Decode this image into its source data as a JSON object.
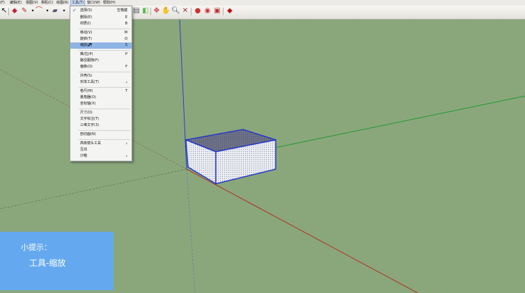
{
  "menubar": {
    "items": [
      "(F)",
      "编辑(E)",
      "视图(V)",
      "相机(C)",
      "绘图(R)",
      "工具(T)",
      "窗口(W)",
      "帮助(H)"
    ]
  },
  "toolbar": {
    "icons": [
      "select-arrow-icon",
      "eraser-icon",
      "pencil-icon",
      "arc-icon",
      "shape-icon",
      "push-pull-icon",
      "orbit-icon",
      "pan-icon",
      "zoom-icon",
      "zoom-extents-icon",
      "warehouse-icon",
      "extension-icon",
      "layout-icon",
      "ruby-icon"
    ]
  },
  "tools_menu": {
    "items": [
      {
        "label": "选择(S)",
        "shortcut": "空格键",
        "checked": true
      },
      {
        "label": "删除(E)",
        "shortcut": "E"
      },
      {
        "label": "材质(I)",
        "shortcut": "B"
      },
      {
        "label": "移动(V)",
        "shortcut": "M"
      },
      {
        "label": "旋转(T)",
        "shortcut": "Q"
      },
      {
        "label": "缩放(C)",
        "shortcut": "S",
        "highlighted": true
      },
      {
        "label": "推/拉(P)",
        "shortcut": "P"
      },
      {
        "label": "路径跟随(F)",
        "shortcut": ""
      },
      {
        "label": "偏移(O)",
        "shortcut": "F"
      },
      {
        "label": "外壳(S)",
        "shortcut": ""
      },
      {
        "label": "实体工具(T)",
        "shortcut": "",
        "submenu": true
      },
      {
        "label": "卷尺(M)",
        "shortcut": "T"
      },
      {
        "label": "量角器(O)",
        "shortcut": ""
      },
      {
        "label": "坐标轴(X)",
        "shortcut": ""
      },
      {
        "label": "尺寸(D)",
        "shortcut": ""
      },
      {
        "label": "文字标注(T)",
        "shortcut": ""
      },
      {
        "label": "三维文字(3)",
        "shortcut": ""
      },
      {
        "label": "剖切面(N)",
        "shortcut": ""
      },
      {
        "label": "高级镜头工具",
        "shortcut": "",
        "submenu": true
      },
      {
        "label": "互动",
        "shortcut": ""
      },
      {
        "label": "沙箱",
        "shortcut": "",
        "submenu": true
      }
    ]
  },
  "tip": {
    "title": "小提示：",
    "body": "工具-缩放"
  },
  "colors": {
    "background": "#8aa77c",
    "axis_blue": "#2b3fbf",
    "axis_red": "#b0331f",
    "axis_green": "#1e9a2c",
    "highlight": "#8fb4e6",
    "tip_bg": "#64a9f0"
  }
}
